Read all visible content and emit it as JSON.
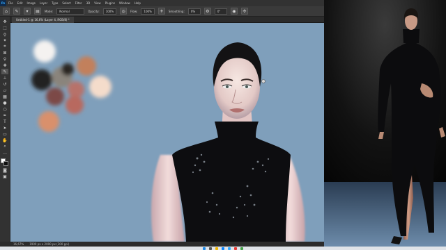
{
  "app": {
    "logo": "Ps",
    "menus": [
      "File",
      "Edit",
      "Image",
      "Layer",
      "Type",
      "Select",
      "Filter",
      "3D",
      "View",
      "Plugins",
      "Window",
      "Help"
    ]
  },
  "options_bar": {
    "mode_label": "Mode:",
    "mode_value": "Normal",
    "opacity_label": "Opacity:",
    "opacity_value": "100%",
    "flow_label": "Flow:",
    "flow_value": "100%",
    "smoothing_label": "Smoothing:",
    "smoothing_value": "0%",
    "angle_value": "0°"
  },
  "document": {
    "tab_title": "Untitled-1 @ 16,6% (Layer 4, RGB/8) *"
  },
  "status_bar": {
    "zoom": "16,67%",
    "doc_size": "1900 px x 2000 px (300 ppi)"
  },
  "colors": {
    "canvas_bg": "#7f9fbb",
    "palette": [
      "#f4f2f0",
      "#2a2624",
      "#8a847c",
      "#c2805c",
      "#212121",
      "#f4dccb",
      "#7c4a46",
      "#b7726a",
      "#b8695f",
      "#d9906c"
    ]
  },
  "icons": {
    "tools": [
      "move-icon",
      "marquee-icon",
      "lasso-icon",
      "magic-wand-icon",
      "crop-icon",
      "frame-icon",
      "eyedropper-icon",
      "healing-icon",
      "brush-icon",
      "clone-stamp-icon",
      "history-brush-icon",
      "eraser-icon",
      "gradient-icon",
      "blur-icon",
      "dodge-icon",
      "pen-icon",
      "type-icon",
      "path-select-icon",
      "shape-icon",
      "hand-icon",
      "zoom-icon",
      "more-tools-icon"
    ]
  }
}
